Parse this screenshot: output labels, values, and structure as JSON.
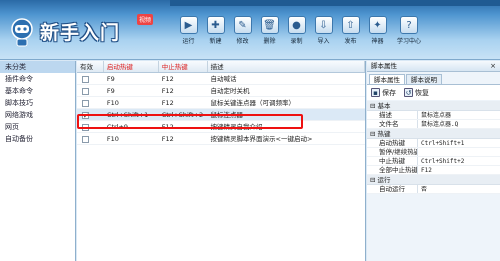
{
  "header": {
    "logo_text": "新手入门",
    "logo_badge": "视频",
    "toolbar": [
      {
        "label": "运行",
        "icon": "run-icon",
        "glyph": "▶"
      },
      {
        "label": "新建",
        "icon": "new-icon",
        "glyph": "✚"
      },
      {
        "label": "修改",
        "icon": "edit-icon",
        "glyph": "✎"
      },
      {
        "label": "删除",
        "icon": "delete-icon",
        "glyph": "🗑"
      },
      {
        "label": "录制",
        "icon": "record-icon",
        "glyph": "●"
      },
      {
        "label": "导入",
        "icon": "import-icon",
        "glyph": "⇩"
      },
      {
        "label": "发布",
        "icon": "publish-icon",
        "glyph": "⇧"
      },
      {
        "label": "神器",
        "icon": "artifact-icon",
        "glyph": "✦"
      },
      {
        "label": "学习中心",
        "icon": "learning-center-icon",
        "glyph": "?"
      }
    ]
  },
  "sidebar": {
    "items": [
      {
        "label": "未分类",
        "selected": true
      },
      {
        "label": "插件命令",
        "selected": false
      },
      {
        "label": "基本命令",
        "selected": false
      },
      {
        "label": "脚本技巧",
        "selected": false
      },
      {
        "label": "网络游戏",
        "selected": false
      },
      {
        "label": "网页",
        "selected": false
      },
      {
        "label": "自动备份",
        "selected": false
      }
    ]
  },
  "table": {
    "headers": {
      "enabled": "有效",
      "start_hotkey": "启动热键",
      "stop_hotkey": "中止热键",
      "description": "描述"
    },
    "rows": [
      {
        "checked": false,
        "start": "F9",
        "stop": "F12",
        "desc": "自动喊话"
      },
      {
        "checked": false,
        "start": "F9",
        "stop": "F12",
        "desc": "自动定时关机"
      },
      {
        "checked": false,
        "start": "F10",
        "stop": "F12",
        "desc": "鼠标关键连点器（可调频率）"
      },
      {
        "checked": true,
        "start": "Ctrl+Shift+1",
        "stop": "Ctrl+Shift+2",
        "desc": "鼠标连点器"
      },
      {
        "checked": false,
        "start": "Ctrl+9",
        "stop": "F12",
        "desc": "按键精灵自我介绍"
      },
      {
        "checked": false,
        "start": "F10",
        "stop": "F12",
        "desc": "按键精灵脚本界面演示<一键启动>"
      }
    ]
  },
  "properties": {
    "title": "脚本属性",
    "close": "×",
    "tabs": [
      "脚本属性",
      "脚本说明"
    ],
    "save_label": "保存",
    "restore_label": "恢复",
    "sections": [
      {
        "name": "基本",
        "rows": [
          {
            "key": "描述",
            "value": "鼠标连点器"
          },
          {
            "key": "文件名",
            "value": "鼠标连点器.Q"
          }
        ]
      },
      {
        "name": "热键",
        "rows": [
          {
            "key": "启动热键",
            "value": "Ctrl+Shift+1"
          },
          {
            "key": "暂停/继续热键",
            "value": ""
          },
          {
            "key": "中止热键",
            "value": "Ctrl+Shift+2"
          },
          {
            "key": "全部中止热键",
            "value": "F12"
          }
        ]
      },
      {
        "name": "运行",
        "rows": [
          {
            "key": "自动运行",
            "value": "否"
          }
        ]
      }
    ]
  },
  "colors": {
    "highlight_border": "#e11111",
    "header_blue": "#2a6aa6",
    "red_header_text": "#dd2222"
  }
}
